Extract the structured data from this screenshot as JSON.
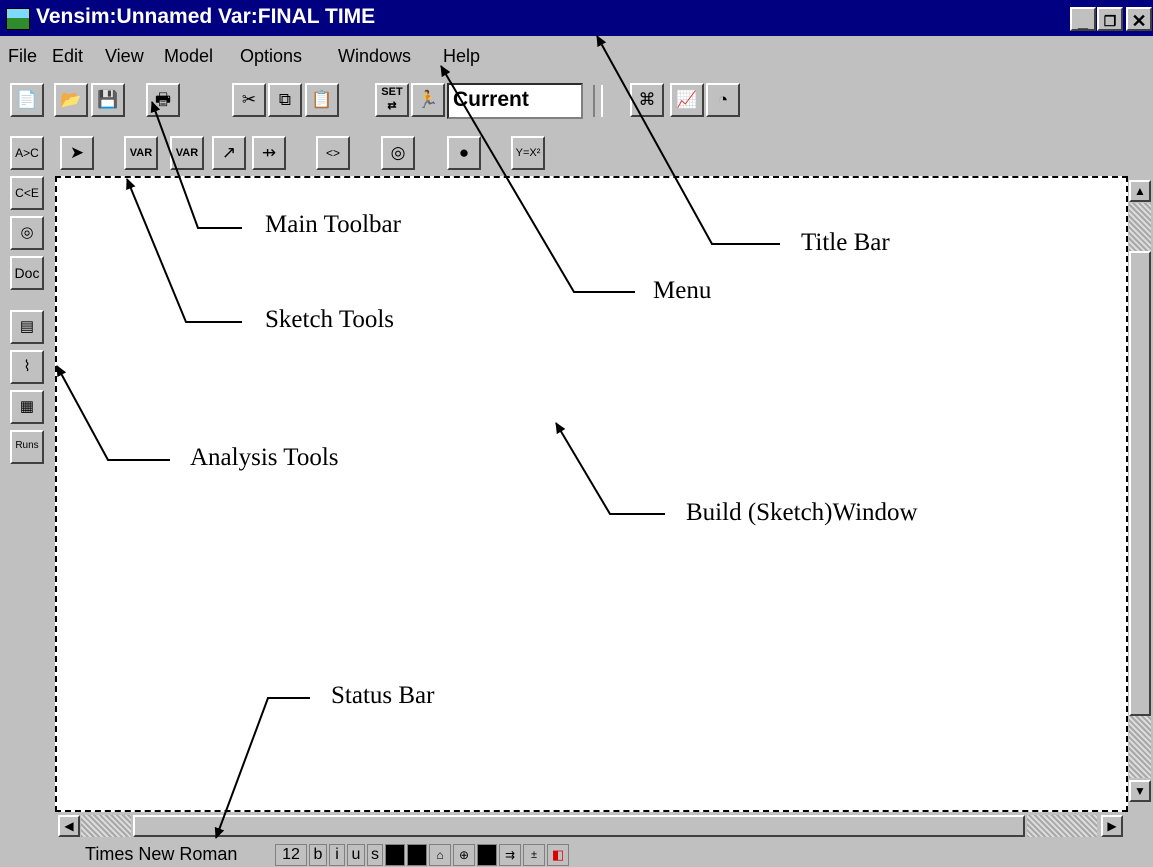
{
  "title_bar": {
    "title": "Vensim:Unnamed Var:FINAL TIME",
    "min": "_",
    "max": "❐",
    "close": "✕"
  },
  "menu": [
    "File",
    "Edit",
    "View",
    "Model",
    "Options",
    "Windows",
    "Help"
  ],
  "main_toolbar": {
    "buttons": [
      "new-file",
      "open",
      "save",
      "print",
      "cut",
      "copy",
      "paste",
      "set-run",
      "simulate"
    ],
    "combo_value": "Current",
    "right_buttons": [
      "model-tree",
      "graph",
      "gauge"
    ]
  },
  "sketch_tools": {
    "items": [
      "pointer",
      "variable",
      "box-variable",
      "arrow",
      "rate",
      "shadow",
      "input-output",
      "delete",
      "equations"
    ],
    "glyphs": {
      "pointer": "➤",
      "variable": "VAR",
      "box-variable": "VAR",
      "arrow": "↗",
      "rate": "⇸",
      "shadow": "<>",
      "input-output": "◎",
      "delete": "●",
      "equations": "Y=X²"
    }
  },
  "analysis_tools": {
    "items": [
      "causes-tree",
      "uses-tree",
      "loops",
      "doc",
      "causes-strip",
      "graph",
      "table",
      "runs-compare"
    ],
    "labels": [
      "A>C",
      "C<E",
      "◎",
      "Doc",
      "▤",
      "⌇",
      "▦",
      "Runs"
    ]
  },
  "status_bar": {
    "font": "Times New Roman",
    "size": "12",
    "style_buttons": [
      "b",
      "i",
      "u",
      "s"
    ]
  },
  "annotations": {
    "title_bar": "Title Bar",
    "menu": "Menu",
    "main_toolbar": "Main Toolbar",
    "sketch_tools": "Sketch Tools",
    "analysis_tools": "Analysis Tools",
    "build_window": "Build (Sketch)Window",
    "status_bar": "Status Bar"
  }
}
